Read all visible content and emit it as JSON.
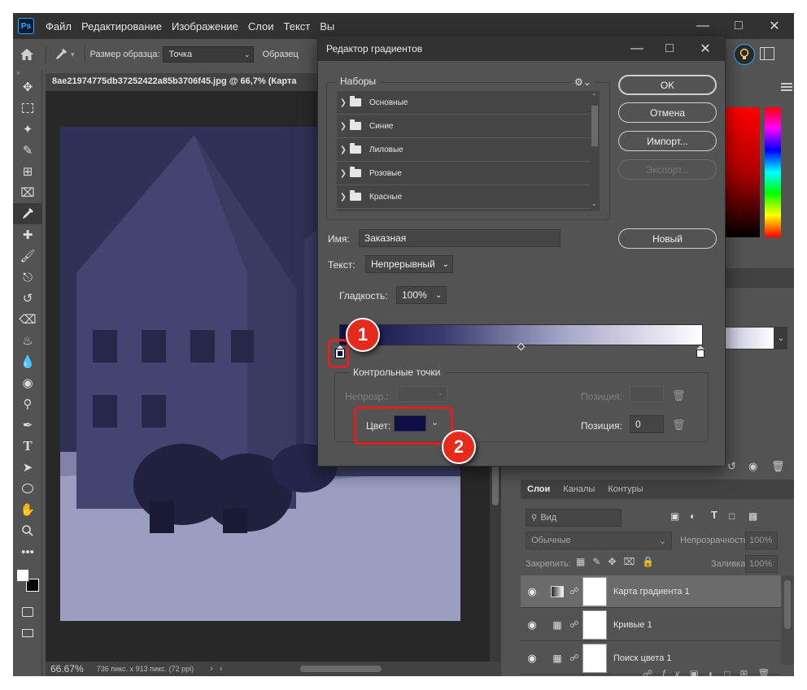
{
  "menubar": {
    "items": [
      "Файл",
      "Редактирование",
      "Изображение",
      "Слои",
      "Текст",
      "Вы"
    ]
  },
  "options": {
    "sample_size_label": "Размер образца:",
    "sample_size_value": "Точка",
    "sample_label": "Образец"
  },
  "document": {
    "tab_title": "8ae21974775db37252422a85b3706f45.jpg @ 66,7% (Карта",
    "zoom": "66.67%",
    "info": "736 пикс. x 913 пикс. (72 ppi)"
  },
  "layers": {
    "tabs": [
      "Слои",
      "Каналы",
      "Контуры"
    ],
    "search_placeholder": "Вид",
    "blend_mode": "Обычные",
    "opacity_label": "Непрозрачность:",
    "opacity_value": "100%",
    "lock_label": "Закрепить:",
    "fill_label": "Заливка:",
    "fill_value": "100%",
    "rows": [
      {
        "name": "Карта градиента 1"
      },
      {
        "name": "Кривые 1"
      },
      {
        "name": "Поиск цвета 1"
      }
    ]
  },
  "dialog": {
    "title": "Редактор градиентов",
    "presets_label": "Наборы",
    "presets": [
      "Основные",
      "Синие",
      "Лиловые",
      "Розовые",
      "Красные"
    ],
    "buttons": {
      "ok": "OK",
      "cancel": "Отмена",
      "import": "Импорт...",
      "export": "Экспорт...",
      "new": "Новый"
    },
    "name_label": "Имя:",
    "name_value": "Заказная",
    "type_label": "Текст:",
    "type_value": "Непрерывный",
    "smooth_label": "Гладкость:",
    "smooth_value": "100%",
    "stops_label": "Контрольные точки",
    "opacity_label": "Непрозр.:",
    "position_label_1": "Позиция:",
    "color_label": "Цвет:",
    "position_label_2": "Позиция:",
    "position_value": "0",
    "stop_color": "#0e0f45"
  },
  "annotations": {
    "badge_1": "1",
    "badge_2": "2"
  }
}
